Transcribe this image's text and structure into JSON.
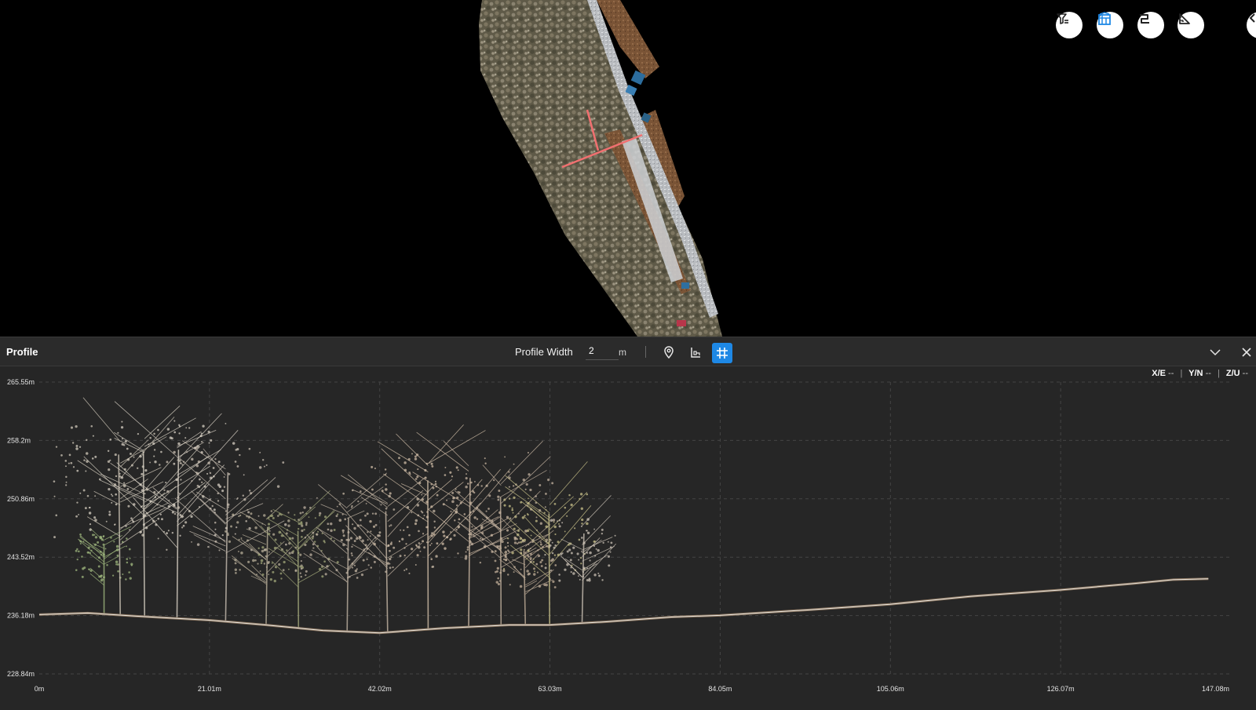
{
  "toolbar": {
    "buttons": [
      {
        "name": "filter-button",
        "icon": "filter-icon",
        "active": false
      },
      {
        "name": "map-layer-button",
        "icon": "map-layers-icon",
        "active": true
      },
      {
        "name": "profile-route-button",
        "icon": "route-icon",
        "active": false
      },
      {
        "name": "measure-button",
        "icon": "ruler-triangle-icon",
        "active": false
      }
    ]
  },
  "profile": {
    "title": "Profile",
    "width_label": "Profile Width",
    "width_value": "2",
    "width_unit": "m",
    "icons": {
      "locate": "map-pin-icon",
      "ground": "ground-profile-icon",
      "grid": "grid-icon"
    },
    "coords": {
      "x_label": "X/E",
      "x_value": "--",
      "y_label": "Y/N",
      "y_value": "--",
      "z_label": "Z/U",
      "z_value": "--"
    }
  },
  "chart_data": {
    "type": "scatter",
    "title": "",
    "xlabel": "",
    "ylabel": "",
    "x_ticks": [
      "0m",
      "21.01m",
      "42.02m",
      "63.03m",
      "84.05m",
      "105.06m",
      "126.07m",
      "147.08m"
    ],
    "y_ticks": [
      "265.55m",
      "258.2m",
      "250.86m",
      "243.52m",
      "236.18m",
      "228.84m"
    ],
    "xlim": [
      0,
      147.08
    ],
    "ylim": [
      228.84,
      265.55
    ],
    "grid": true,
    "ground_profile": [
      [
        0,
        236.3
      ],
      [
        6,
        236.5
      ],
      [
        12,
        236.1
      ],
      [
        21,
        235.6
      ],
      [
        28,
        235.0
      ],
      [
        35,
        234.3
      ],
      [
        42,
        234.0
      ],
      [
        50,
        234.6
      ],
      [
        58,
        235.0
      ],
      [
        63,
        235.0
      ],
      [
        70,
        235.4
      ],
      [
        78,
        236.0
      ],
      [
        84,
        236.2
      ],
      [
        95,
        236.9
      ],
      [
        105,
        237.6
      ],
      [
        115,
        238.6
      ],
      [
        126,
        239.4
      ],
      [
        135,
        240.2
      ],
      [
        140,
        240.7
      ],
      [
        144.3,
        240.8
      ]
    ],
    "trees": [
      {
        "x": 8,
        "top": 246.5,
        "color": "#9fb77e"
      },
      {
        "x": 10,
        "top": 260.0,
        "color": "#cfc7b8"
      },
      {
        "x": 13,
        "top": 260.5,
        "color": "#d8d2c4"
      },
      {
        "x": 17,
        "top": 260.8,
        "color": "#d8d0c4"
      },
      {
        "x": 23,
        "top": 257.5,
        "color": "#c9bfb2"
      },
      {
        "x": 28,
        "top": 249.5,
        "color": "#b7ad98"
      },
      {
        "x": 32,
        "top": 249.0,
        "color": "#a2a77a"
      },
      {
        "x": 38,
        "top": 251.0,
        "color": "#bfb2a2"
      },
      {
        "x": 43,
        "top": 252.0,
        "color": "#c7b8a6"
      },
      {
        "x": 48,
        "top": 256.5,
        "color": "#d2bfa8"
      },
      {
        "x": 53,
        "top": 256.8,
        "color": "#cdb9a4"
      },
      {
        "x": 57,
        "top": 254.0,
        "color": "#c4b3a0"
      },
      {
        "x": 60,
        "top": 246.0,
        "color": "#c0ad98"
      },
      {
        "x": 63,
        "top": 251.5,
        "color": "#c8c089"
      },
      {
        "x": 67,
        "top": 248.5,
        "color": "#cbc2b5"
      }
    ]
  }
}
